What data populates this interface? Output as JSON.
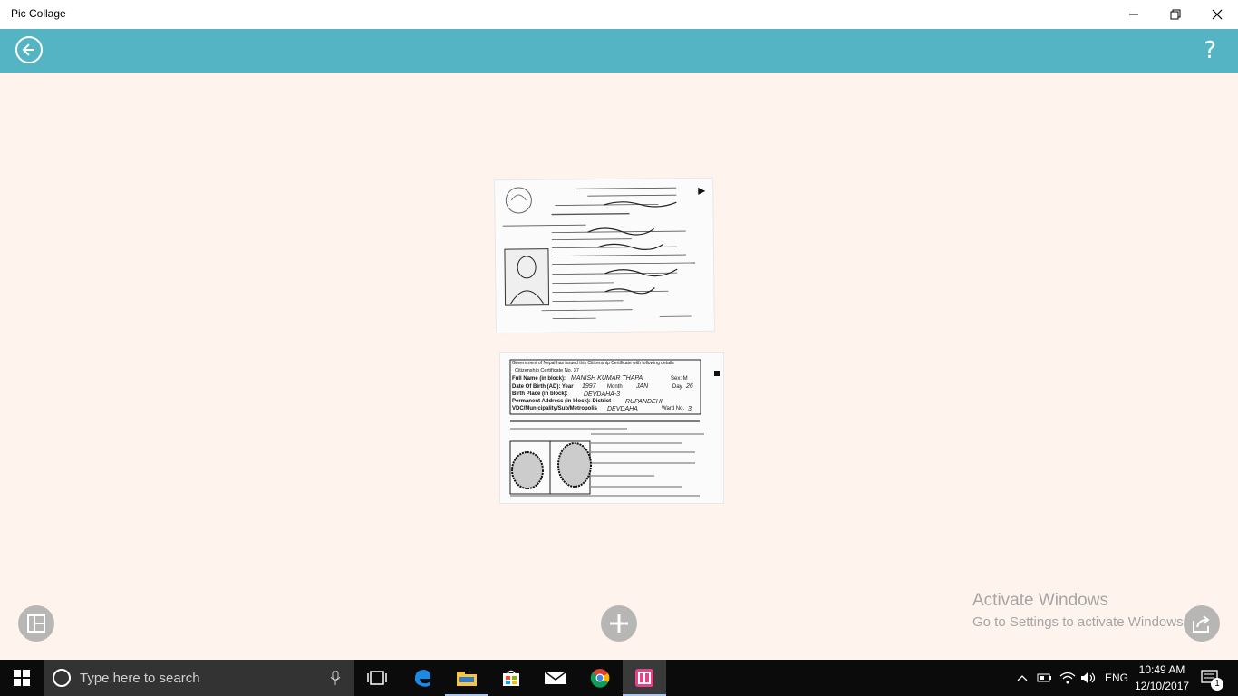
{
  "window": {
    "title": "Pic Collage",
    "minimize_icon": "minimize-icon",
    "maximize_icon": "restore-icon",
    "close_icon": "close-icon"
  },
  "appbar": {
    "back_icon": "back-arrow-icon",
    "help_label": "?",
    "accent_color": "#55b4c3"
  },
  "canvas": {
    "background": "#fff3ee",
    "photos": [
      {
        "name": "citizenship-certificate-front",
        "description_shown": "Nepali citizenship certificate front with photo"
      },
      {
        "name": "citizenship-certificate-back",
        "description_shown": "Citizenship certificate back with fingerprints"
      }
    ],
    "photo_texts": {
      "back_line1": "Government of Nepal has issued this Citizenship Certificate with following details",
      "back_line2": "Citizenship Certificate No. 37",
      "back_name_label": "Full Name (in block):",
      "back_name_value": "MANISH KUMAR THAPA",
      "back_sex": "Sex: M",
      "back_dob_label": "Date Of Birth (AD): Year",
      "back_dob_year": "1997",
      "back_dob_month_label": "Month",
      "back_dob_month": "JAN",
      "back_dob_day_label": "Day",
      "back_dob_day": "26",
      "back_birthplace_label": "Birth Place (in block):",
      "back_birthplace_value": "DEVDAHA-3",
      "back_address_label": "Permanent Address (in block): District",
      "back_address_district": "RUPANDEHI",
      "back_vdc_label": "VDC/Municipality/Sub/Metropolis",
      "back_vdc_value": "DEVDAHA",
      "back_ward_label": "Ward No.",
      "back_ward_value": "3"
    }
  },
  "bottom_bar": {
    "layout_icon": "layout-icon",
    "add_icon": "add-icon",
    "share_icon": "share-icon"
  },
  "watermark": {
    "title": "Activate Windows",
    "subtitle": "Go to Settings to activate Windows."
  },
  "taskbar": {
    "search_placeholder": "Type here to search",
    "apps": [
      "task-view",
      "edge",
      "file-explorer",
      "store",
      "mail",
      "chrome",
      "pic-collage"
    ],
    "language": "ENG",
    "time": "10:49 AM",
    "date": "12/10/2017",
    "notification_count": "1"
  }
}
